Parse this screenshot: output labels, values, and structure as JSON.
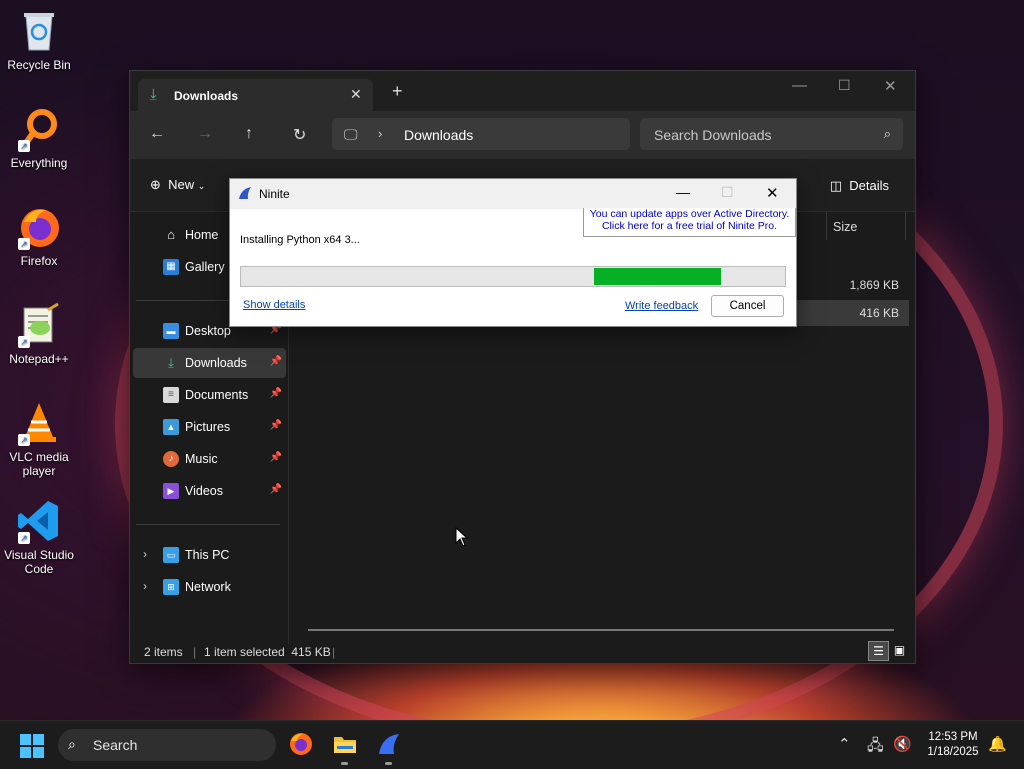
{
  "desktop": {
    "icons": [
      {
        "label": "Recycle Bin",
        "icon": "recycle-bin-icon"
      },
      {
        "label": "Everything",
        "icon": "everything-search-icon"
      },
      {
        "label": "Firefox",
        "icon": "firefox-icon"
      },
      {
        "label": "Notepad++",
        "icon": "notepad-plus-plus-icon"
      },
      {
        "label": "VLC media player",
        "icon": "vlc-icon"
      },
      {
        "label": "Visual Studio Code",
        "icon": "vscode-icon"
      }
    ]
  },
  "explorer": {
    "tab": {
      "title": "Downloads"
    },
    "address": {
      "crumb": "Downloads",
      "separator": "›"
    },
    "search": {
      "placeholder": "Search Downloads"
    },
    "toolbar": {
      "new_label": "New",
      "details_label": "Details"
    },
    "sidebar": {
      "items": [
        {
          "label": "Home",
          "icon": "home-icon"
        },
        {
          "label": "Gallery",
          "icon": "gallery-icon"
        },
        {
          "label": "Desktop",
          "icon": "desktop-icon",
          "pinned": true
        },
        {
          "label": "Downloads",
          "icon": "downloads-icon",
          "pinned": true,
          "selected": true
        },
        {
          "label": "Documents",
          "icon": "documents-icon",
          "pinned": true
        },
        {
          "label": "Pictures",
          "icon": "pictures-icon",
          "pinned": true
        },
        {
          "label": "Music",
          "icon": "music-icon",
          "pinned": true
        },
        {
          "label": "Videos",
          "icon": "videos-icon",
          "pinned": true
        },
        {
          "label": "This PC",
          "icon": "this-pc-icon"
        },
        {
          "label": "Network",
          "icon": "network-icon"
        }
      ]
    },
    "columns": {
      "size": "Size"
    },
    "rows": [
      {
        "size": "1,869 KB",
        "selected": false
      },
      {
        "size": "416 KB",
        "selected": true
      }
    ],
    "status": {
      "items": "2 items",
      "selection": "1 item selected  415 KB"
    }
  },
  "ninite": {
    "title": "Ninite",
    "promo_line1": "You can update apps over Active Directory.",
    "promo_line2": "Click here for a free trial of Ninite Pro.",
    "status": "Installing Python x64 3...",
    "progress": {
      "start_fraction": 0.648,
      "end_fraction": 0.883
    },
    "show_details": "Show details",
    "write_feedback": "Write feedback",
    "cancel": "Cancel",
    "colors": {
      "progress": "#06b025",
      "link": "#0645ad"
    }
  },
  "taskbar": {
    "search_label": "Search",
    "apps": [
      "firefox-icon",
      "file-explorer-icon",
      "ninite-icon"
    ],
    "time": "12:53 PM",
    "date": "1/18/2025",
    "accent": "#4cc2ff"
  }
}
